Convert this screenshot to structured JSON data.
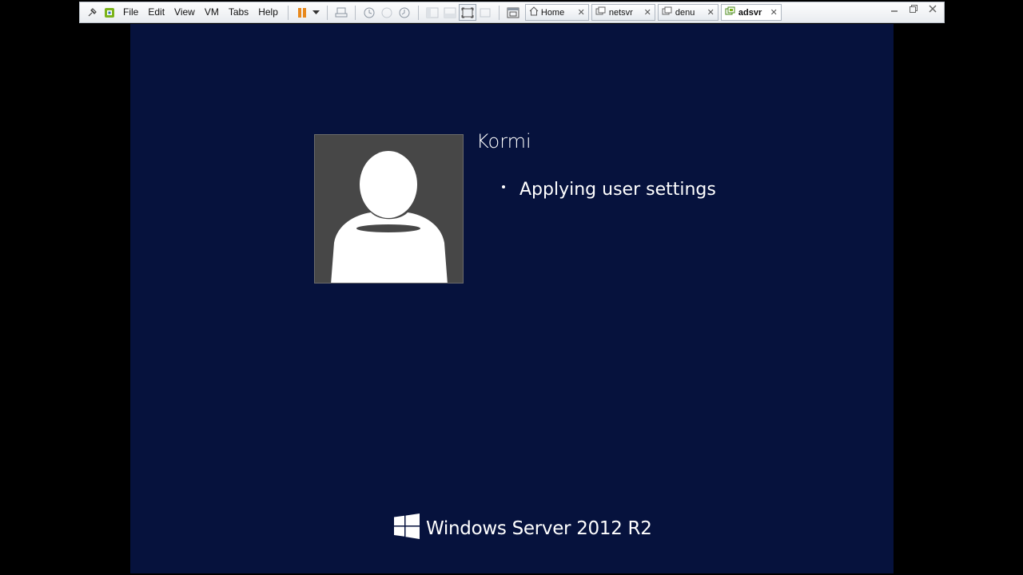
{
  "menu": {
    "file": "File",
    "edit": "Edit",
    "view": "View",
    "vm": "VM",
    "tabs": "Tabs",
    "help": "Help"
  },
  "tabs": [
    {
      "label": "Home",
      "icon": "home-icon"
    },
    {
      "label": "netsvr",
      "icon": "vm-icon"
    },
    {
      "label": "denu",
      "icon": "vm-icon"
    },
    {
      "label": "adsvr",
      "icon": "vm-icon",
      "active": true
    }
  ],
  "tab_close_glyph": "✕",
  "login": {
    "username": "Kormi",
    "status": "Applying user settings"
  },
  "brand": {
    "text": "Windows Server 2012 R2"
  },
  "colors": {
    "screen_background": "#06123d",
    "avatar_background": "#474747",
    "pause_icon": "#e8891d"
  }
}
